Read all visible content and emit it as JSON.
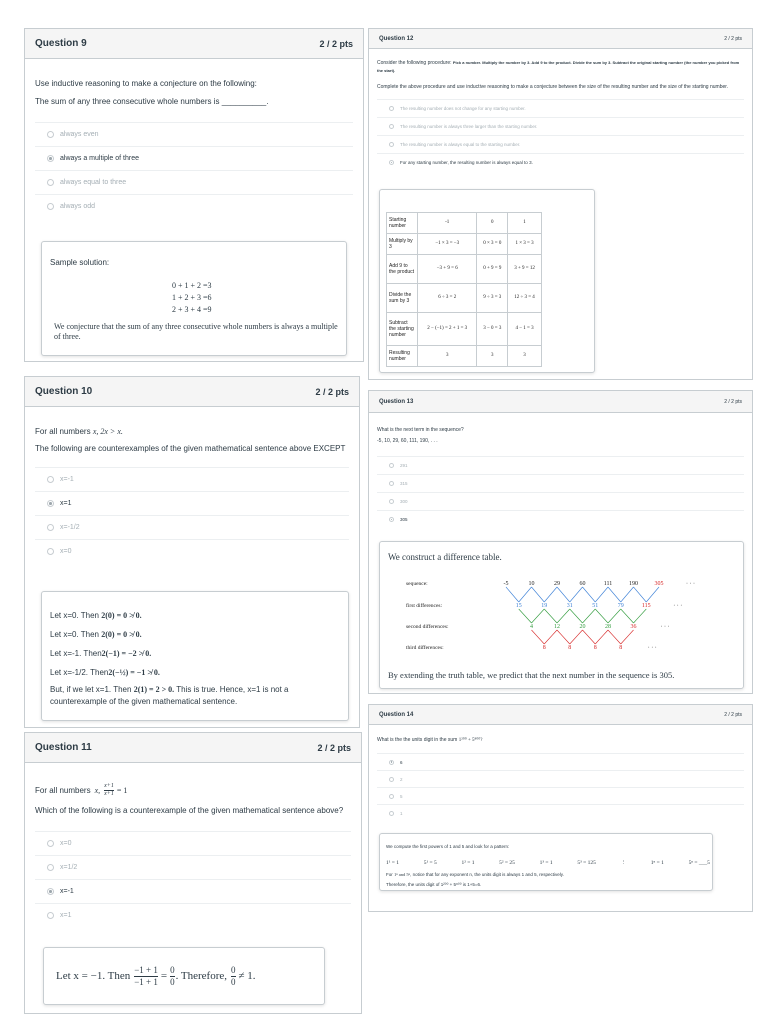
{
  "q9": {
    "title": "Question 9",
    "points": "2 / 2 pts",
    "prompt1": "Use inductive reasoning to make a conjecture on the following:",
    "prompt2": "The sum of any three consecutive whole numbers is __________.",
    "options": [
      "always even",
      "always a multiple of three",
      "always equal to three",
      "always odd"
    ],
    "selected_index": 1,
    "solution_label": "Sample solution:",
    "equations": [
      "0 + 1 + 2 =3",
      "1 + 2 + 3 =6",
      "2 + 3 + 4 =9"
    ],
    "conclusion": "We conjecture that the sum of any three consecutive whole numbers is always a multiple of three."
  },
  "q10": {
    "title": "Question 10",
    "points": "2 / 2 pts",
    "stmt_prefix": "For all numbers",
    "stmt_math": "x, 2x > x.",
    "prompt": "The following are counterexamples of the given mathematical sentence above EXCEPT",
    "options": [
      "x=-1",
      "x=1",
      "x=-1/2",
      "x=0"
    ],
    "selected_index": 1,
    "lines": [
      {
        "pre": "Let x=0. Then ",
        "math": "2(0) = 0 ≯ 0."
      },
      {
        "pre": "Let x=0. Then ",
        "math": "2(0) = 0 ≯ 0."
      },
      {
        "pre": "Let x=-1. Then",
        "math": "2(−1) = −2 ≯ 0."
      },
      {
        "pre": "Let x=-1/2. Then",
        "math": "2(−½) = −1 ≯ 0."
      }
    ],
    "last_pre": "But, if we let x=1. Then ",
    "last_math": "2(1) = 2 > 0.",
    "last_post": " This is true. Hence, x=1 is not a",
    "last_line2": "counterexample of the given mathematical sentence."
  },
  "q11": {
    "title": "Question 11",
    "points": "2 / 2 pts",
    "stmt_prefix": "For all numbers",
    "frac_num": "x+1",
    "frac_den": "x+1",
    "stmt_rhs": "= 1",
    "prompt": "Which of the following is a counterexample of the given mathematical sentence above?",
    "options": [
      "x=0",
      "x=1/2",
      "x=-1",
      "x=1"
    ],
    "selected_index": 2,
    "sol_let": "Let x = −1. Then",
    "sol_num": "−1 + 1",
    "sol_den": "−1 + 1",
    "sol_eq": "=",
    "sol_f2_num": "0",
    "sol_f2_den": "0",
    "sol_therefore": ". Therefore,",
    "sol_f3_num": "0",
    "sol_f3_den": "0",
    "sol_neq": "≠ 1."
  },
  "q12": {
    "title": "Question 12",
    "points": "2 / 2 pts",
    "line1_prefix": "Consider the following procedure:",
    "line1_bold": "Pick a number. Multiply the number by 3. Add 9 to the product. Divide the sum by 3. Subtract the original starting number (the number you picked from the start).",
    "line2": "Complete the above procedure and use inductive reasoning to make a conjecture between the size of the resulting number and the size of the starting number.",
    "options": [
      "The resulting number does not change for any starting number.",
      "The resulting number is always three larger than the starting number.",
      "The resulting number is always equal to the starting number.",
      "For any starting number, the resulting number is always equal to 3."
    ],
    "selected_index": 3,
    "table": [
      [
        "Starting number",
        "-1",
        "0",
        "1"
      ],
      [
        "Multiply by 3",
        "−1 × 3 = −3",
        "0 × 3 = 0",
        "1 × 3 = 3"
      ],
      [
        "Add 9 to the product",
        "−3 + 9 = 6",
        "0 + 9 = 9",
        "3 + 9 = 12"
      ],
      [
        "Divide the sum by 3",
        "6 ÷ 3 = 2",
        "9 ÷ 3 = 3",
        "12 ÷ 3 = 4"
      ],
      [
        "Subtract the starting number",
        "2 − (−1) = 2 + 1 = 3",
        "3 − 0 = 3",
        "4 − 1 = 3"
      ],
      [
        "Resulting number",
        "3",
        "3",
        "3"
      ]
    ]
  },
  "q13": {
    "title": "Question 13",
    "points": "2 / 2 pts",
    "prompt": "What is the next term in the sequence?",
    "sequence": "-5, 10, 29, 60, 111, 190, . . .",
    "options": [
      "291",
      "315",
      "300",
      "305"
    ],
    "selected_index": 3,
    "sol_head": "We construct a difference table.",
    "row_labels": [
      "sequence:",
      "first differences:",
      "second differences:",
      "third differences:"
    ],
    "seq_vals": [
      "-5",
      "10",
      "29",
      "60",
      "111",
      "190",
      "305"
    ],
    "first_diffs": [
      "15",
      "19",
      "31",
      "51",
      "79",
      "115"
    ],
    "second_diffs": [
      "4",
      "12",
      "20",
      "28",
      "36"
    ],
    "third_diffs": [
      "8",
      "8",
      "8",
      "8"
    ],
    "dots": "· · ·",
    "colors": {
      "black": "#222222",
      "blue": "#3a7fd6",
      "green": "#2e9a3a",
      "red": "#d62424"
    },
    "conclusion": "By extending the truth table, we predict that the next number in the sequence is 305."
  },
  "q14": {
    "title": "Question 14",
    "points": "2 / 2 pts",
    "prompt_pre": "What is the the units digit in the sum",
    "prompt_math": "1²⁰⁰ + 5⁸⁰⁰?",
    "options": [
      "6",
      "2",
      "5",
      "1"
    ],
    "selected_index": 0,
    "sol_line1": "We compute the first powers of 1 and 5 and look for a pattern:",
    "sol_powers": [
      "1¹ = 1",
      "5¹ = 5",
      "1² = 1",
      "5² = 25",
      "1³ = 1",
      "5³ = 125",
      "⋮",
      "1ⁿ = 1",
      "5ⁿ = ___5"
    ],
    "sol_line3_pre": "For",
    "sol_line3_math": "1ⁿ and 5ⁿ",
    "sol_line3_post": ", notice that for any exponent n, the units digit is always 1 and 5, respectively.",
    "sol_line4": "Therefore, the units digit of 1²⁰⁰ + 5⁸⁰⁰ is 1+5=6."
  }
}
